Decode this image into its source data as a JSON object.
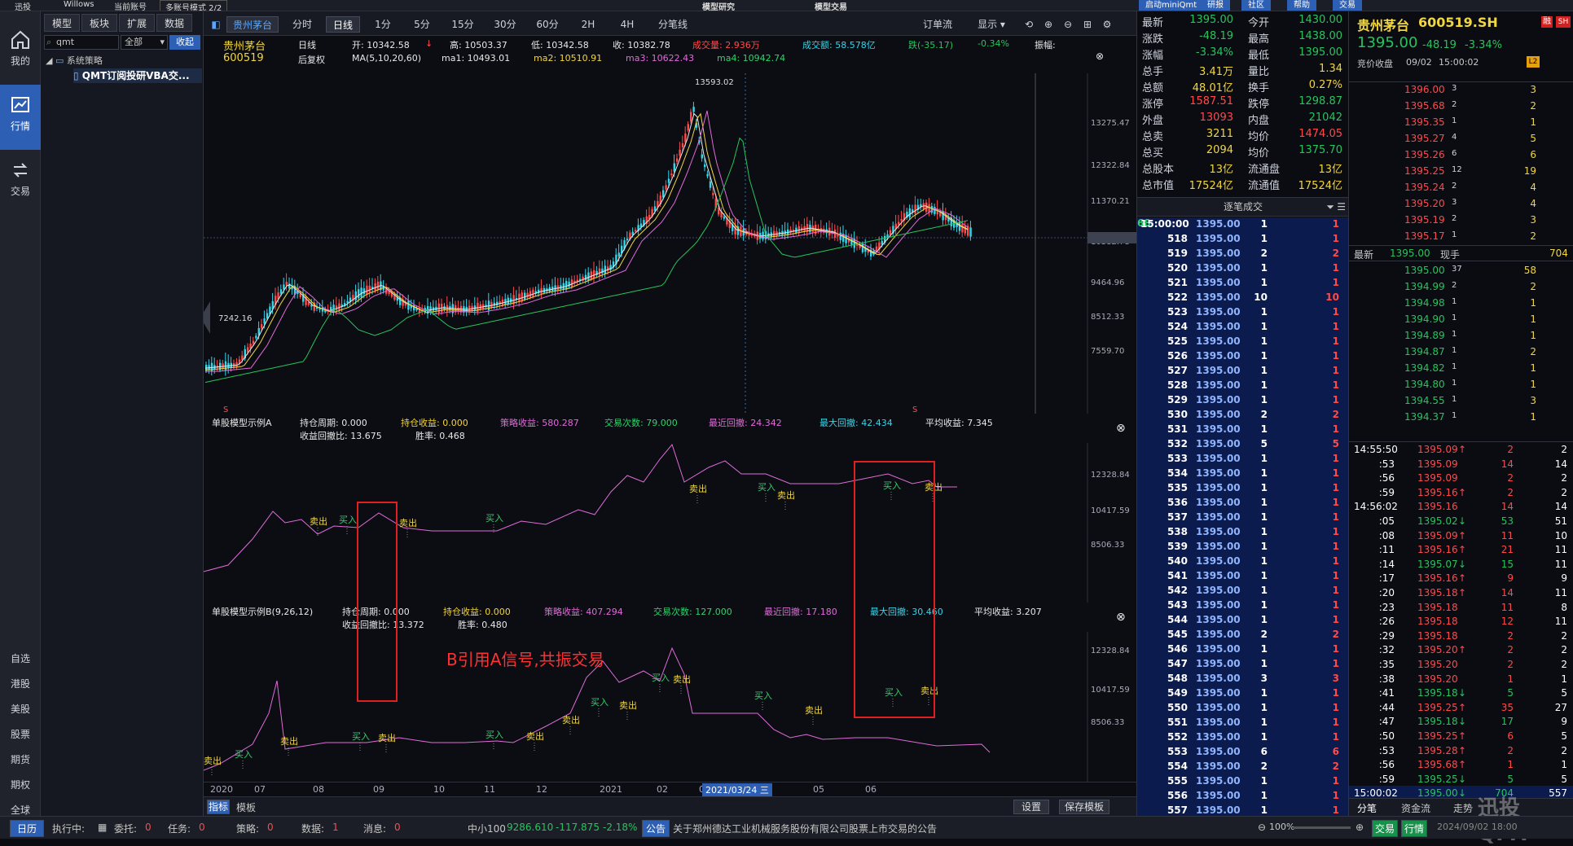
{
  "topbar": {
    "app": "迅投",
    "account": "Willows",
    "current_account_label": "当前账号",
    "mode_select": "多账号模式 2/2",
    "tab_research": "模型研究",
    "tab_trade": "模型交易",
    "btn_mini": "启动miniQmt",
    "btn_research": "研报",
    "btn_community": "社区",
    "btn_help": "帮助",
    "btn_trade": "交易"
  },
  "leftnav": {
    "items": [
      {
        "label": "我的",
        "icon": "home-icon"
      },
      {
        "label": "行情",
        "icon": "chart-icon"
      },
      {
        "label": "交易",
        "icon": "swap-icon"
      }
    ],
    "bottom": [
      "自选",
      "港股",
      "美股",
      "股票",
      "期货",
      "期权",
      "全球"
    ]
  },
  "leftpanel": {
    "tabs": [
      "模型",
      "板块",
      "扩展",
      "数据"
    ],
    "search_value": "qmt",
    "filter": "全部",
    "collapse": "收起",
    "tree_root": "系统策略",
    "tree_item": "QMT订阅投研VBA交..."
  },
  "toolbar": {
    "stock_name": "贵州茅台",
    "periods": [
      "分时",
      "日线",
      "1分",
      "5分",
      "15分",
      "30分",
      "60分",
      "2H",
      "4H",
      "分笔线"
    ],
    "selected_period": "日线",
    "order_flow": "订单流",
    "display": "显示"
  },
  "info": {
    "name": "贵州茅台",
    "code": "600519",
    "period": "日线",
    "adjust": "后复权",
    "ma_label": "MA(5,10,20,60)",
    "open": "开: 10342.58",
    "high": "高: 10503.37",
    "low": "低: 10342.58",
    "close": "收: 10382.78",
    "volume": "成交量: 2.936万",
    "amount": "成交额: 58.578亿",
    "change": "跌(-35.17)",
    "change_pct": "-0.34%",
    "amplitude": "振幅:",
    "ma1": "ma1: 10493.01",
    "ma2": "ma2: 10510.91",
    "ma3": "ma3: 10622.43",
    "ma4": "ma4: 10942.74"
  },
  "main_axis": [
    "13275.47",
    "12322.84",
    "11370.21",
    "10382.78",
    "9464.96",
    "8512.33",
    "7559.70"
  ],
  "main_annot": {
    "high": "13593.02",
    "low": "7242.16",
    "markerS1": "S",
    "markerS2": "S"
  },
  "strat1": {
    "title": "单股模型示例A",
    "hold_period": "持仓周期: 0.000",
    "hold_profit": "持仓收益: 0.000",
    "strat_profit": "策略收益: 580.287",
    "trade_count": "交易次数: 79.000",
    "recent_dd": "最近回撤: 24.342",
    "max_dd": "最大回撤: 42.434",
    "avg_profit": "平均收益: 7.345",
    "ret_dd_ratio": "收益回撤比: 13.675",
    "win_rate": "胜率: 0.468",
    "axis": [
      "12328.84",
      "10417.59",
      "8506.33"
    ]
  },
  "strat2": {
    "title": "单股模型示例B(9,26,12)",
    "hold_period": "持仓周期: 0.000",
    "hold_profit": "持仓收益: 0.000",
    "strat_profit": "策略收益: 407.294",
    "trade_count": "交易次数: 127.000",
    "recent_dd": "最近回撤: 17.180",
    "max_dd": "最大回撤: 30.460",
    "avg_profit": "平均收益: 3.207",
    "ret_dd_ratio": "收益回撤比: 13.372",
    "win_rate": "胜率: 0.480",
    "axis": [
      "12328.84",
      "10417.59",
      "8506.33"
    ],
    "annotation": "B引用A信号,共振交易"
  },
  "signals": {
    "buy": "买入",
    "sell": "卖出"
  },
  "xaxis": [
    "2020",
    "07",
    "08",
    "09",
    "10",
    "11",
    "12",
    "2021",
    "02",
    "03",
    "05",
    "06"
  ],
  "xaxis_cursor": "2021/03/24 三",
  "chart_bottom": {
    "tab_indicator": "指标",
    "tab_template": "模板",
    "settings": "设置",
    "save_template": "保存模板"
  },
  "quote_summary": [
    [
      "最新",
      "1395.00",
      "今开",
      "1430.00"
    ],
    [
      "涨跌",
      "-48.19",
      "最高",
      "1438.00"
    ],
    [
      "涨幅",
      "-3.34%",
      "最低",
      "1395.00"
    ],
    [
      "总手",
      "3.41万",
      "量比",
      "1.34"
    ],
    [
      "总额",
      "48.01亿",
      "换手",
      "0.27%"
    ],
    [
      "涨停",
      "1587.51",
      "跌停",
      "1298.87"
    ],
    [
      "外盘",
      "13093",
      "内盘",
      "21042"
    ],
    [
      "总卖",
      "3211",
      "均价",
      "1474.05"
    ],
    [
      "总买",
      "2094",
      "均价",
      "1375.70"
    ],
    [
      "总股本",
      "13亿",
      "流通盘",
      "13亿"
    ],
    [
      "总市值",
      "17524亿",
      "流通值",
      "17524亿"
    ]
  ],
  "tick_title": "逐笔成交",
  "ticks": {
    "first": {
      "time": "15:00:00",
      "price": "1395.00",
      "vol": "1",
      "right": "1"
    },
    "seqs": [
      "518",
      "519",
      "520",
      "521",
      "522",
      "523",
      "524",
      "525",
      "526",
      "527",
      "528",
      "529",
      "530",
      "531",
      "532",
      "533",
      "534",
      "535",
      "536",
      "537",
      "538",
      "539",
      "540",
      "541",
      "542",
      "543",
      "544",
      "545",
      "546",
      "547",
      "548",
      "549",
      "550",
      "551",
      "552",
      "553",
      "554",
      "555",
      "556",
      "557"
    ],
    "vols": [
      "1",
      "2",
      "1",
      "1",
      "10",
      "1",
      "1",
      "1",
      "1",
      "1",
      "1",
      "1",
      "2",
      "1",
      "5",
      "1",
      "1",
      "1",
      "1",
      "1",
      "1",
      "1",
      "1",
      "1",
      "1",
      "1",
      "1",
      "2",
      "1",
      "1",
      "3",
      "1",
      "1",
      "1",
      "1",
      "6",
      "2",
      "1",
      "1",
      "1"
    ],
    "price": "1395.00",
    "mid_value": "68"
  },
  "stock": {
    "name": "贵州茅台",
    "code": "600519.SH",
    "price": "1395.00",
    "change": "-48.19",
    "pct": "-3.34%",
    "status": "竞价收盘",
    "date": "09/02",
    "time": "15:00:02",
    "flag1": "融",
    "flag2": "SH",
    "level": "L2"
  },
  "asks": [
    [
      "1396.00",
      "3",
      "3"
    ],
    [
      "1395.68",
      "2",
      "2"
    ],
    [
      "1395.35",
      "1",
      "1"
    ],
    [
      "1395.27",
      "4",
      "5"
    ],
    [
      "1395.26",
      "6",
      "6"
    ],
    [
      "1395.25",
      "12",
      "19"
    ],
    [
      "1395.24",
      "2",
      "4"
    ],
    [
      "1395.20",
      "3",
      "4"
    ],
    [
      "1395.19",
      "2",
      "3"
    ],
    [
      "1395.17",
      "1",
      "2"
    ]
  ],
  "latest": {
    "label": "最新",
    "price": "1395.00",
    "hand_label": "现手",
    "hand": "704"
  },
  "bids": [
    [
      "1395.00",
      "37",
      "58"
    ],
    [
      "1394.99",
      "2",
      "2"
    ],
    [
      "1394.98",
      "1",
      "1"
    ],
    [
      "1394.90",
      "1",
      "1"
    ],
    [
      "1394.89",
      "1",
      "1"
    ],
    [
      "1394.87",
      "1",
      "2"
    ],
    [
      "1394.82",
      "1",
      "1"
    ],
    [
      "1394.80",
      "1",
      "1"
    ],
    [
      "1394.55",
      "1",
      "3"
    ],
    [
      "1394.37",
      "1",
      "1"
    ]
  ],
  "trades": [
    [
      "14:55:50",
      "1395.09",
      "up",
      "2",
      "2"
    ],
    [
      ":53",
      "1395.09",
      "",
      "14",
      "14"
    ],
    [
      ":56",
      "1395.09",
      "",
      "2",
      "2"
    ],
    [
      ":59",
      "1395.16",
      "up",
      "2",
      "2"
    ],
    [
      "14:56:02",
      "1395.16",
      "",
      "14",
      "14"
    ],
    [
      ":05",
      "1395.02",
      "dn",
      "53",
      "51"
    ],
    [
      ":08",
      "1395.09",
      "up",
      "11",
      "10"
    ],
    [
      ":11",
      "1395.16",
      "up",
      "21",
      "11"
    ],
    [
      ":14",
      "1395.07",
      "dn",
      "15",
      "11"
    ],
    [
      ":17",
      "1395.16",
      "up",
      "9",
      "9"
    ],
    [
      ":20",
      "1395.18",
      "up",
      "14",
      "11"
    ],
    [
      ":23",
      "1395.18",
      "",
      "11",
      "8"
    ],
    [
      ":26",
      "1395.18",
      "",
      "12",
      "11"
    ],
    [
      ":29",
      "1395.18",
      "",
      "2",
      "2"
    ],
    [
      ":32",
      "1395.20",
      "up",
      "2",
      "2"
    ],
    [
      ":35",
      "1395.20",
      "",
      "2",
      "2"
    ],
    [
      ":38",
      "1395.20",
      "",
      "1",
      "1"
    ],
    [
      ":41",
      "1395.18",
      "dn",
      "5",
      "5"
    ],
    [
      ":44",
      "1395.25",
      "up",
      "35",
      "27"
    ],
    [
      ":47",
      "1395.18",
      "dn",
      "17",
      "9"
    ],
    [
      ":50",
      "1395.25",
      "up",
      "6",
      "5"
    ],
    [
      ":53",
      "1395.28",
      "up",
      "2",
      "2"
    ],
    [
      ":56",
      "1395.68",
      "up",
      "1",
      "1"
    ],
    [
      ":59",
      "1395.25",
      "dn",
      "5",
      "5"
    ],
    [
      "15:00:02",
      "1395.00",
      "dn",
      "704",
      "557"
    ]
  ],
  "quote_tabs": [
    "分笔",
    "资金流",
    "走势"
  ],
  "watermark": "迅投QMT",
  "status": {
    "daily": "日历",
    "executing": "执行中:",
    "entrust": "委托:",
    "entrust_n": "0",
    "task": "任务:",
    "task_n": "0",
    "strategy": "策略:",
    "strategy_n": "0",
    "data": "数据:",
    "data_n": "1",
    "msg": "消息:",
    "msg_n": "0",
    "index_name": "中小100",
    "index_val": "9286.610",
    "index_chg": "-117.875",
    "index_pct": "-2.18%",
    "notice_label": "公告",
    "notice": "关于郑州德达工业机械服务股份有限公司股票上市交易的公告",
    "zoom": "100%",
    "btn_trade": "交易",
    "btn_quote": "行情",
    "datetime": "2024/09/02 18:00"
  }
}
